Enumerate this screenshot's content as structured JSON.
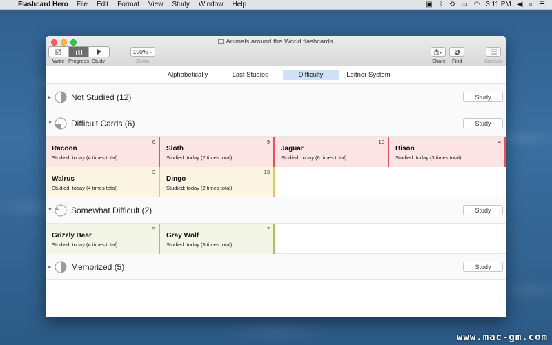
{
  "menubar": {
    "app_name": "Flashcard Hero",
    "items": [
      "File",
      "Edit",
      "Format",
      "View",
      "Study",
      "Window",
      "Help"
    ],
    "time": "3:11 PM"
  },
  "window": {
    "title": "Animals around the World.flashcards"
  },
  "toolbar": {
    "modes": [
      {
        "label": "Write",
        "icon": "pencil-icon"
      },
      {
        "label": "Progress",
        "icon": "bar-chart-icon",
        "active": true
      },
      {
        "label": "Study",
        "icon": "play-icon"
      }
    ],
    "zoom_value": "100%",
    "zoom_label": "Zoom",
    "share_label": "Share",
    "find_label": "Find",
    "sidebar_label": "Sidebar"
  },
  "sort_tabs": [
    "Alphabetically",
    "Last Studied",
    "Difficulty",
    "Leitner System"
  ],
  "active_sort": "Difficulty",
  "sections": [
    {
      "title": "Not Studied (12)",
      "study_label": "Study",
      "expanded": false,
      "cards": []
    },
    {
      "title": "Difficult Cards (6)",
      "study_label": "Study",
      "expanded": true,
      "cards": [
        {
          "name": "Racoon",
          "studied": "Studied: today (4 times total)",
          "count": "6",
          "level": "hard"
        },
        {
          "name": "Sloth",
          "studied": "Studied: today (2 times total)",
          "count": "9",
          "level": "hard"
        },
        {
          "name": "Jaguar",
          "studied": "Studied: today (6 times total)",
          "count": "10",
          "level": "hard"
        },
        {
          "name": "Bison",
          "studied": "Studied: today (3 times total)",
          "count": "4",
          "level": "hard"
        },
        {
          "name": "Walrus",
          "studied": "Studied: today (4 times total)",
          "count": "3",
          "level": "medium"
        },
        {
          "name": "Dingo",
          "studied": "Studied: today (2 times total)",
          "count": "13",
          "level": "medium"
        }
      ]
    },
    {
      "title": "Somewhat Difficult (2)",
      "study_label": "Study",
      "expanded": true,
      "cards": [
        {
          "name": "Grizzly Bear",
          "studied": "Studied: today (4 times total)",
          "count": "5",
          "level": "easy"
        },
        {
          "name": "Gray Wolf",
          "studied": "Studied: today (5 times total)",
          "count": "7",
          "level": "easy"
        }
      ]
    },
    {
      "title": "Memorized (5)",
      "study_label": "Study",
      "expanded": false,
      "cards": []
    }
  ],
  "watermark": "www.mac-gm.com",
  "colors": {
    "hard_bg": "#fde4e4",
    "hard_border": "#df5555",
    "medium_bg": "#fdf5e4",
    "medium_border": "#ecc25a",
    "easy_bg": "#f3f5e6",
    "easy_border": "#a7c45a",
    "active_tab": "#cfe1f6"
  }
}
